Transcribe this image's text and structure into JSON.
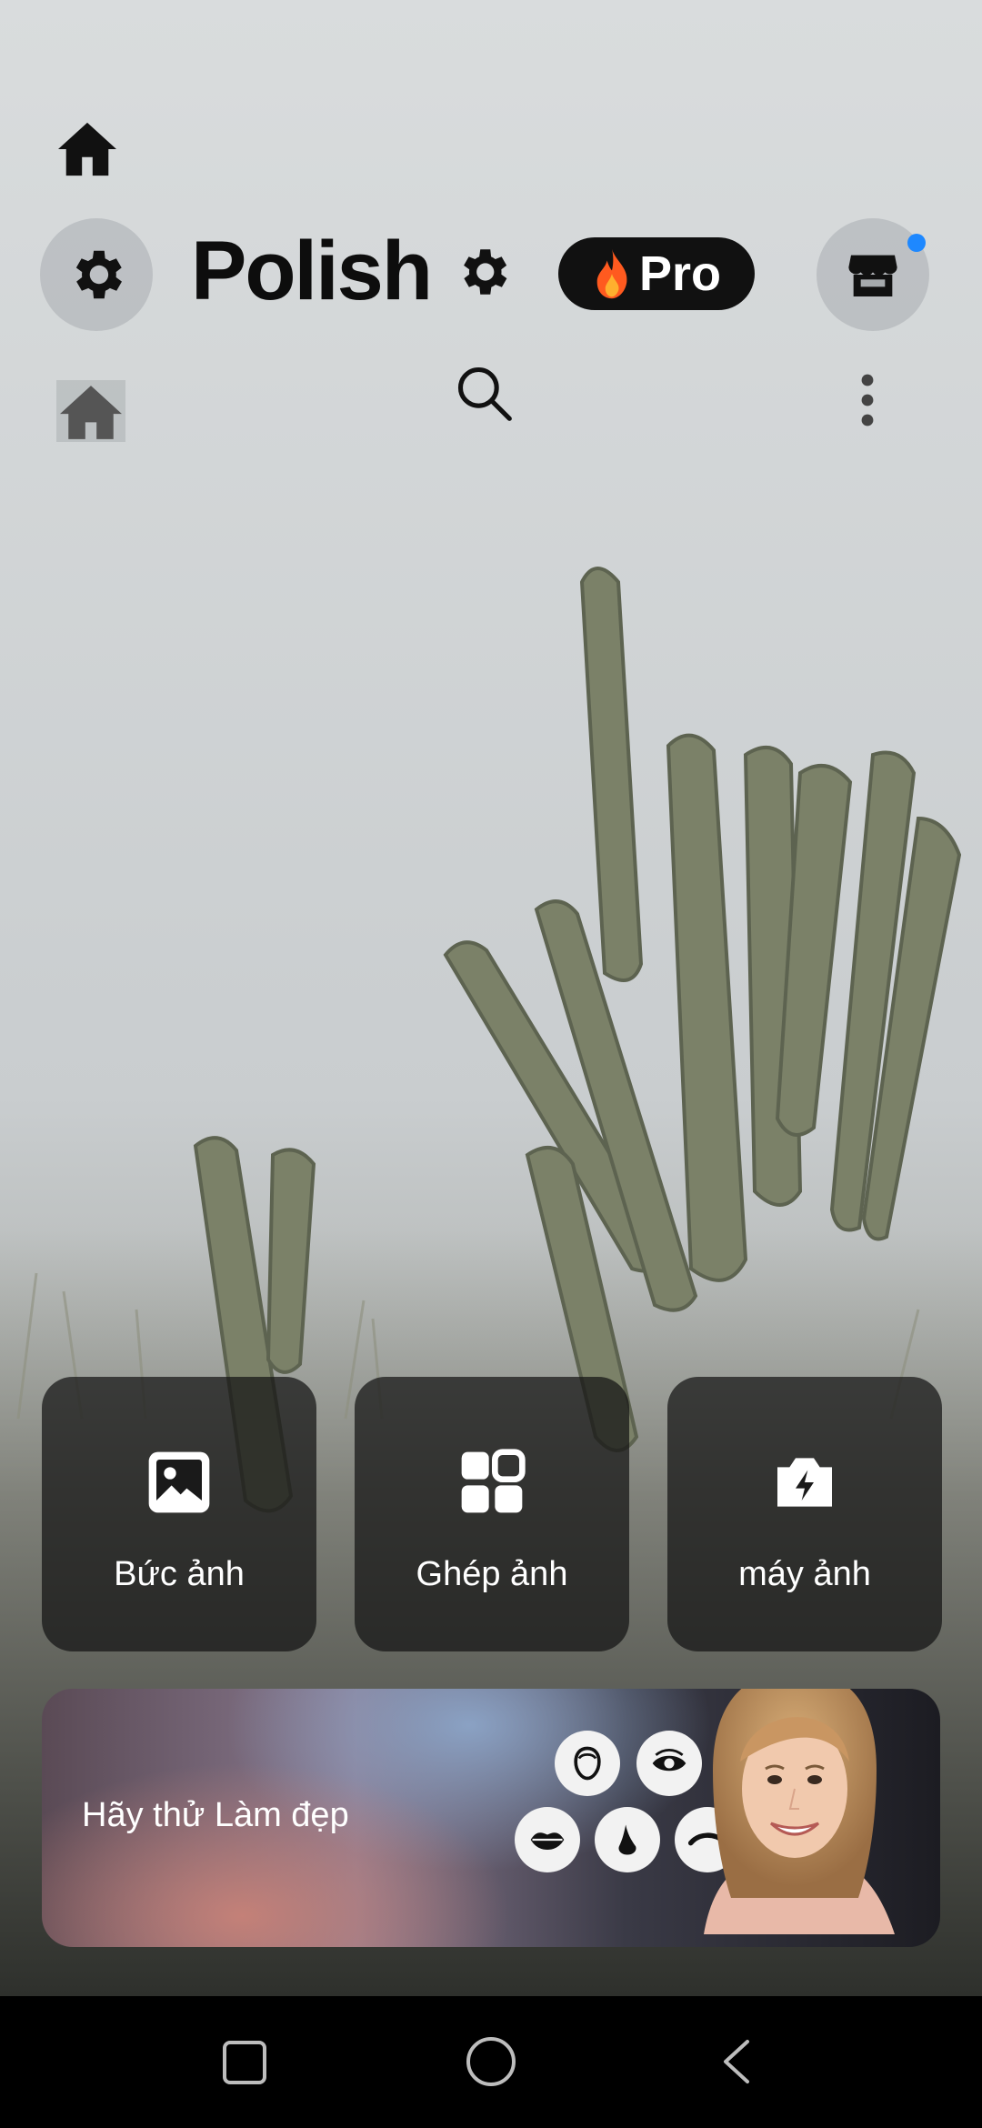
{
  "app": {
    "name": "Polish",
    "pro_label": "Pro"
  },
  "tiles": [
    {
      "label": "Bức ảnh",
      "icon": "image-icon"
    },
    {
      "label": "Ghép ảnh",
      "icon": "collage-grid-icon"
    },
    {
      "label": "máy ảnh",
      "icon": "camera-icon"
    }
  ],
  "banner": {
    "text": "Hãy thử Làm đẹp",
    "features": [
      "face-shape-icon",
      "eye-icon",
      "lips-icon",
      "nose-icon",
      "eyebrow-icon"
    ]
  },
  "icons": {
    "home_top": "home-icon",
    "settings": "gear-icon",
    "store": "store-icon",
    "search": "search-icon",
    "more": "more-vertical-icon"
  },
  "colors": {
    "pro_pill": "#111111",
    "notification_dot": "#1e88ff",
    "flame": "#ff5a1f"
  },
  "system_nav": [
    "recents-button",
    "home-button",
    "back-button"
  ]
}
